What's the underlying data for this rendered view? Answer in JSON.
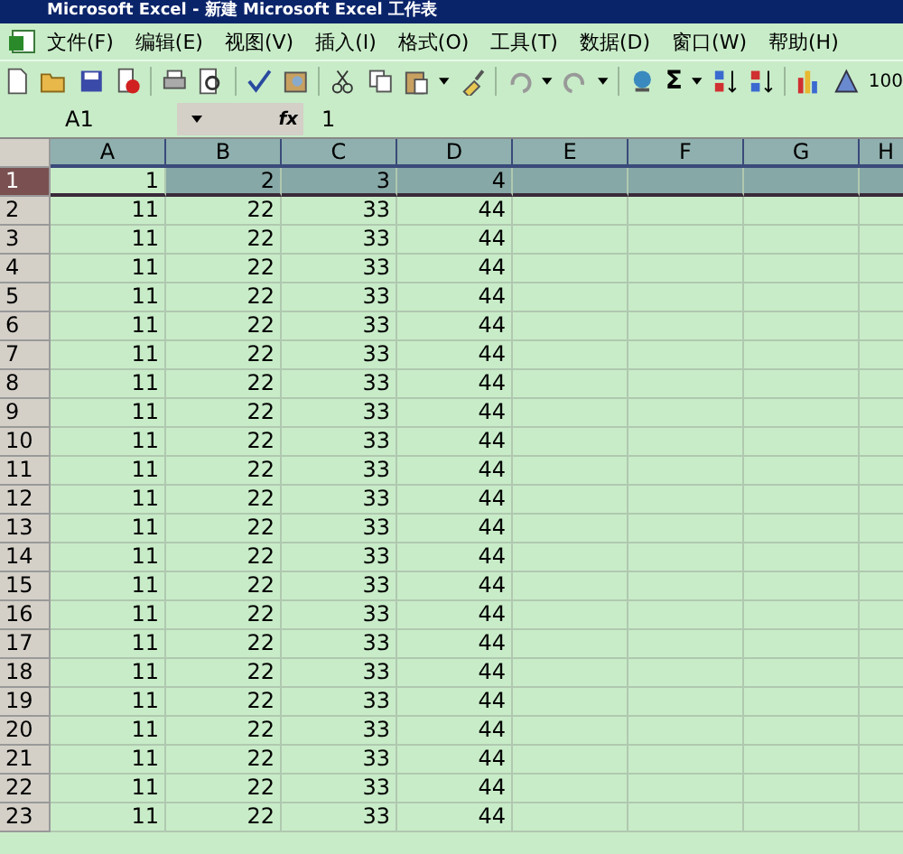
{
  "window": {
    "title": "Microsoft Excel - 新建 Microsoft Excel 工作表"
  },
  "menu": [
    "文件(F)",
    "编辑(E)",
    "视图(V)",
    "插入(I)",
    "格式(O)",
    "工具(T)",
    "数据(D)",
    "窗口(W)",
    "帮助(H)"
  ],
  "toolbar": {
    "sum_symbol": "Σ",
    "zoom": "100"
  },
  "formula_bar": {
    "name_box": "A1",
    "fx": "fx",
    "value": "1"
  },
  "columns": [
    {
      "label": "A",
      "selected": true
    },
    {
      "label": "B",
      "selected": true
    },
    {
      "label": "C",
      "selected": true
    },
    {
      "label": "D",
      "selected": true
    },
    {
      "label": "E",
      "selected": true
    },
    {
      "label": "F",
      "selected": true
    },
    {
      "label": "G",
      "selected": true
    },
    {
      "label": "H",
      "selected": true
    }
  ],
  "rows": [
    {
      "header": "1",
      "selected": true,
      "cells": [
        "1",
        "2",
        "3",
        "4"
      ]
    },
    {
      "header": "2",
      "selected": false,
      "cells": [
        "11",
        "22",
        "33",
        "44"
      ]
    },
    {
      "header": "3",
      "selected": false,
      "cells": [
        "11",
        "22",
        "33",
        "44"
      ]
    },
    {
      "header": "4",
      "selected": false,
      "cells": [
        "11",
        "22",
        "33",
        "44"
      ]
    },
    {
      "header": "5",
      "selected": false,
      "cells": [
        "11",
        "22",
        "33",
        "44"
      ]
    },
    {
      "header": "6",
      "selected": false,
      "cells": [
        "11",
        "22",
        "33",
        "44"
      ]
    },
    {
      "header": "7",
      "selected": false,
      "cells": [
        "11",
        "22",
        "33",
        "44"
      ]
    },
    {
      "header": "8",
      "selected": false,
      "cells": [
        "11",
        "22",
        "33",
        "44"
      ]
    },
    {
      "header": "9",
      "selected": false,
      "cells": [
        "11",
        "22",
        "33",
        "44"
      ]
    },
    {
      "header": "10",
      "selected": false,
      "cells": [
        "11",
        "22",
        "33",
        "44"
      ]
    },
    {
      "header": "11",
      "selected": false,
      "cells": [
        "11",
        "22",
        "33",
        "44"
      ]
    },
    {
      "header": "12",
      "selected": false,
      "cells": [
        "11",
        "22",
        "33",
        "44"
      ]
    },
    {
      "header": "13",
      "selected": false,
      "cells": [
        "11",
        "22",
        "33",
        "44"
      ]
    },
    {
      "header": "14",
      "selected": false,
      "cells": [
        "11",
        "22",
        "33",
        "44"
      ]
    },
    {
      "header": "15",
      "selected": false,
      "cells": [
        "11",
        "22",
        "33",
        "44"
      ]
    },
    {
      "header": "16",
      "selected": false,
      "cells": [
        "11",
        "22",
        "33",
        "44"
      ]
    },
    {
      "header": "17",
      "selected": false,
      "cells": [
        "11",
        "22",
        "33",
        "44"
      ]
    },
    {
      "header": "18",
      "selected": false,
      "cells": [
        "11",
        "22",
        "33",
        "44"
      ]
    },
    {
      "header": "19",
      "selected": false,
      "cells": [
        "11",
        "22",
        "33",
        "44"
      ]
    },
    {
      "header": "20",
      "selected": false,
      "cells": [
        "11",
        "22",
        "33",
        "44"
      ]
    },
    {
      "header": "21",
      "selected": false,
      "cells": [
        "11",
        "22",
        "33",
        "44"
      ]
    },
    {
      "header": "22",
      "selected": false,
      "cells": [
        "11",
        "22",
        "33",
        "44"
      ]
    },
    {
      "header": "23",
      "selected": false,
      "cells": [
        "11",
        "22",
        "33",
        "44"
      ]
    }
  ]
}
